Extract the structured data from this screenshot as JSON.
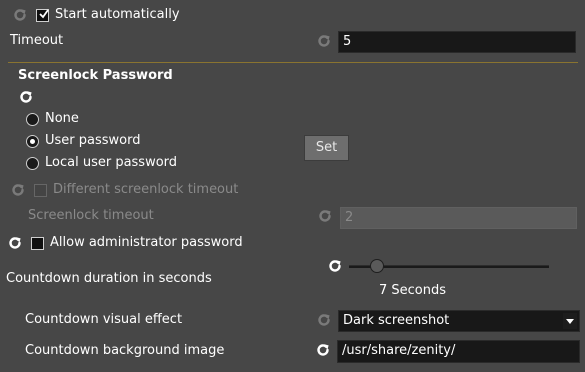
{
  "general": {
    "start_automatically": {
      "label": "Start automatically",
      "checked": true
    },
    "timeout": {
      "label": "Timeout",
      "value": "5"
    }
  },
  "screenlock": {
    "section_title": "Screenlock Password",
    "options": [
      {
        "label": "None",
        "selected": false
      },
      {
        "label": "User password",
        "selected": true
      },
      {
        "label": "Local user password",
        "selected": false
      }
    ],
    "set_button": "Set",
    "different_timeout": {
      "label": "Different screenlock timeout",
      "checked": false,
      "enabled": false
    },
    "screenlock_timeout": {
      "label": "Screenlock timeout",
      "value": "2",
      "enabled": false
    },
    "allow_admin": {
      "label": "Allow administrator password",
      "checked": false
    }
  },
  "countdown": {
    "duration": {
      "label": "Countdown duration in seconds",
      "value_text": "7 Seconds",
      "value": 7
    },
    "visual_effect": {
      "label": "Countdown visual effect",
      "selected": "Dark screenshot"
    },
    "background_image": {
      "label": "Countdown background image",
      "value": "/usr/share/zenity/"
    }
  },
  "colors": {
    "background": "#474747",
    "entry_background": "#181818",
    "separator": "#8a7430"
  }
}
